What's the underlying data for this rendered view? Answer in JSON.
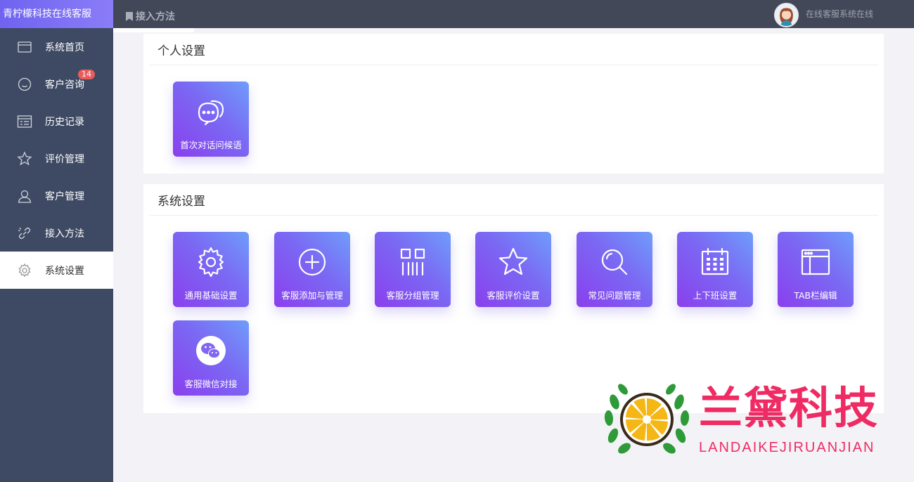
{
  "app": {
    "brand": "青柠檬科技在线客服"
  },
  "sidebar": {
    "items": [
      {
        "label": "系统首页",
        "icon": "window-icon"
      },
      {
        "label": "客户咨询",
        "icon": "smile-icon",
        "badge": "14"
      },
      {
        "label": "历史记录",
        "icon": "calendar-list-icon"
      },
      {
        "label": "评价管理",
        "icon": "star-icon"
      },
      {
        "label": "客户管理",
        "icon": "user-icon"
      },
      {
        "label": "接入方法",
        "icon": "link-icon"
      },
      {
        "label": "系统设置",
        "icon": "gear-icon",
        "active": true
      }
    ]
  },
  "topbar": {
    "tab_label": "接入方法",
    "status": "在线客服系统在线"
  },
  "personal": {
    "title": "个人设置",
    "tiles": [
      {
        "label": "首次对话问候语",
        "icon": "chat-bubbles-icon"
      }
    ]
  },
  "system": {
    "title": "系统设置",
    "tiles": [
      {
        "label": "通用基础设置",
        "icon": "gear-icon"
      },
      {
        "label": "客服添加与管理",
        "icon": "plus-circle-icon"
      },
      {
        "label": "客服分组管理",
        "icon": "group-grid-icon"
      },
      {
        "label": "客服评价设置",
        "icon": "star-icon"
      },
      {
        "label": "常见问题管理",
        "icon": "search-icon"
      },
      {
        "label": "上下班设置",
        "icon": "calendar-icon"
      },
      {
        "label": "TAB栏编辑",
        "icon": "browser-window-icon"
      },
      {
        "label": "客服微信对接",
        "icon": "wechat-icon"
      }
    ]
  },
  "watermark": {
    "title": "兰黛科技",
    "subtitle": "LANDAIKEJIRUANJIAN"
  },
  "colors": {
    "sidebar": "#3e4a63",
    "topbar": "#434858",
    "accent": "#7b68f3",
    "badge": "#ec5b5b",
    "watermark": "#ef2b63"
  }
}
